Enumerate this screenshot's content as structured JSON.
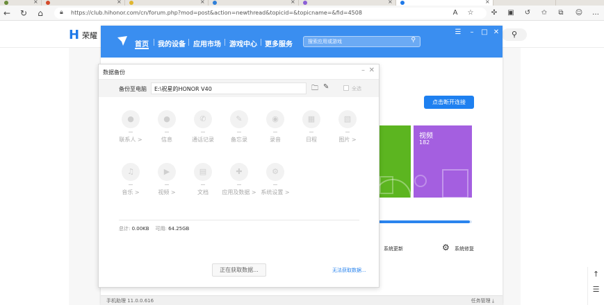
{
  "browser": {
    "url": "https://club.hihonor.com/cn/forum.php?mod=post&action=newthread&topicid=&topicname=&fid=4508",
    "tab_colors": [
      "#6a8c3a",
      "#d44a2a",
      "#e0b62f",
      "#2f7fd8",
      "#8a5ed6"
    ],
    "accent": "#1f79e8"
  },
  "site": {
    "logo_mark": "H",
    "name": "荣耀"
  },
  "app": {
    "nav": [
      "首页",
      "我的设备",
      "应用市场",
      "游戏中心",
      "更多服务"
    ],
    "search_placeholder": "搜索应用或游戏",
    "connect_button": "点击断开连接",
    "tile_purple_title": "视频",
    "tile_purple_count": "182",
    "progress_fraction": 0.98,
    "system_update": "系统更新",
    "system_repair": "系统修复",
    "version": "手机助理 11.0.0.616",
    "task_manager": "任务管理 ⤓",
    "colors": {
      "top_bar": "#3a8ef0",
      "tile_green": "#5cb520",
      "tile_purple": "#a45fe0"
    }
  },
  "dialog": {
    "title": "数据备份",
    "path_label": "备份至电脑",
    "path_value": "E:\\祝星的HONOR V40",
    "select_all": "全选",
    "categories": [
      {
        "label": "联系人 >",
        "icon": "person-icon",
        "glyph": "●"
      },
      {
        "label": "信息",
        "icon": "message-icon",
        "glyph": "●"
      },
      {
        "label": "通话记录",
        "icon": "phone-icon",
        "glyph": "✆"
      },
      {
        "label": "备忘录",
        "icon": "memo-icon",
        "glyph": "✎"
      },
      {
        "label": "录音",
        "icon": "record-icon",
        "glyph": "◉"
      },
      {
        "label": "日程",
        "icon": "calendar-icon",
        "glyph": "▦"
      },
      {
        "label": "图片 >",
        "icon": "image-icon",
        "glyph": "▧"
      },
      {
        "label": "音乐 >",
        "icon": "music-icon",
        "glyph": "♫"
      },
      {
        "label": "视频 >",
        "icon": "video-icon",
        "glyph": "▶"
      },
      {
        "label": "文档",
        "icon": "document-icon",
        "glyph": "▤"
      },
      {
        "label": "应用及数据 >",
        "icon": "app-data-icon",
        "glyph": "✚"
      },
      {
        "label": "系统设置 >",
        "icon": "settings-icon",
        "glyph": "⚙"
      }
    ],
    "total_label": "总计:",
    "total_value": "0.00KB",
    "available_label": "可用:",
    "available_value": "64.25GB",
    "fetch_button": "正在获取数据...",
    "no_data_link": "无法获取数据..."
  }
}
